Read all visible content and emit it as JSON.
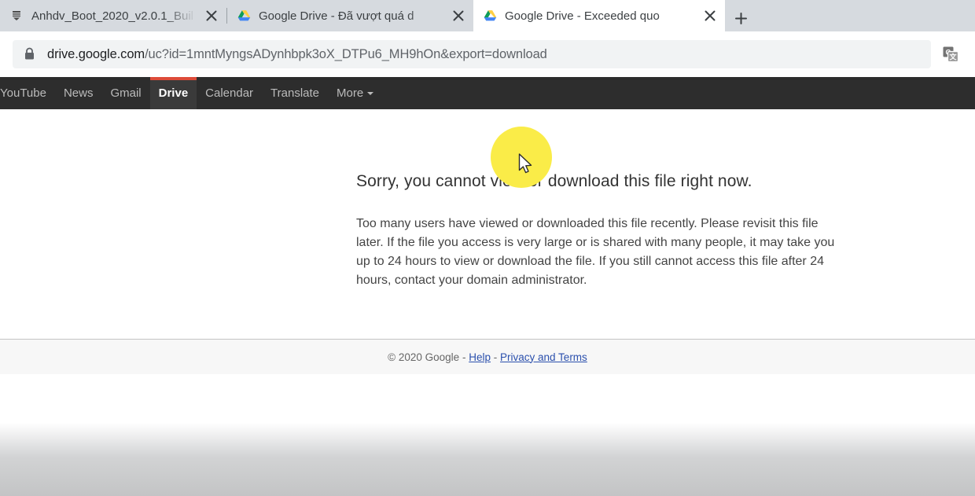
{
  "browser": {
    "tabs": [
      {
        "title": "Anhdv_Boot_2020_v2.0.1_Buil",
        "favicon": "document-icon",
        "active": false,
        "close_label": "Close tab"
      },
      {
        "title": "Google Drive - Đã vượt quá d",
        "favicon": "google-drive-icon",
        "active": false,
        "close_label": "Close tab"
      },
      {
        "title": "Google Drive - Exceeded quo",
        "favicon": "google-drive-icon",
        "active": true,
        "close_label": "Close tab"
      }
    ],
    "new_tab_label": "+",
    "omnibox": {
      "security_icon": "lock-icon",
      "host": "drive.google.com",
      "path": "/uc?id=1mntMyngsADynhbpk3oX_DTPu6_MH9hOn&export=download",
      "translate_icon": "translate-icon"
    }
  },
  "gbar": {
    "items": [
      {
        "label": "YouTube",
        "active": false
      },
      {
        "label": "News",
        "active": false
      },
      {
        "label": "Gmail",
        "active": false
      },
      {
        "label": "Drive",
        "active": true
      },
      {
        "label": "Calendar",
        "active": false
      },
      {
        "label": "Translate",
        "active": false
      },
      {
        "label": "More",
        "active": false,
        "has_caret": true
      }
    ],
    "accent_color": "#dd4b39",
    "background_color": "#2d2d2d"
  },
  "page": {
    "headline": "Sorry, you cannot view or download this file right now.",
    "body": "Too many users have viewed or downloaded this file recently. Please revisit this file later. If the file you access is very large or is shared with many people, it may take you up to 24 hours to view or download the file. If you still cannot access this file after 24 hours, contact your domain administrator.",
    "footer": {
      "copyright": "© 2020 Google",
      "sep1": "-",
      "help_label": "Help",
      "sep2": "-",
      "privacy_label": "Privacy and Terms"
    }
  },
  "overlay": {
    "cursor_icon": "mouse-pointer-icon",
    "highlight_color": "#faec48"
  }
}
